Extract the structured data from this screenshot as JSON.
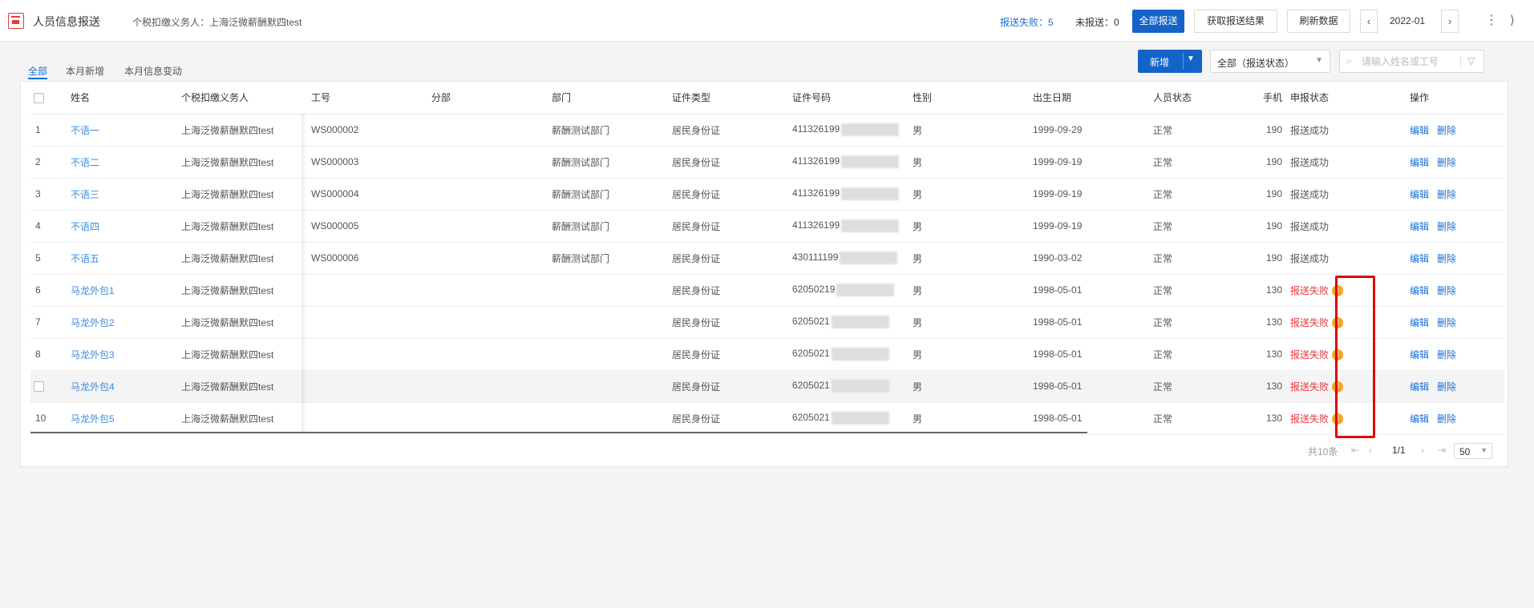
{
  "app": {
    "title": "人员信息报送",
    "payer": "个税扣缴义务人：上海泛微薪酬默四test"
  },
  "stats": {
    "fail": "报送失败：5",
    "pending": "未报送：0"
  },
  "toolbar": {
    "submit_all": "全部报送",
    "fetch_result": "获取报送结果",
    "refresh": "刷新数据",
    "period": "2022-01"
  },
  "tabs": [
    "全部",
    "本月新增",
    "本月信息变动"
  ],
  "filters": {
    "add_label": "新增",
    "status_select": "全部（报送状态）",
    "search_placeholder": "请输入姓名或工号"
  },
  "columns": [
    "姓名",
    "个税扣缴义务人",
    "工号",
    "分部",
    "部门",
    "证件类型",
    "证件号码",
    "性别",
    "出生日期",
    "人员状态",
    "手机",
    "申报状态",
    "操作"
  ],
  "rows": [
    {
      "idx": "1",
      "name": "不语一",
      "payer": "上海泛微薪酬默四test",
      "empno": "WS000002",
      "branch": "",
      "dept": "薪酬测试部门",
      "idtype": "居民身份证",
      "idno": "411326199",
      "gender": "男",
      "birth": "1999-09-29",
      "status": "正常",
      "phone": "190",
      "report": "报送成功",
      "fail": false
    },
    {
      "idx": "2",
      "name": "不语二",
      "payer": "上海泛微薪酬默四test",
      "empno": "WS000003",
      "branch": "",
      "dept": "薪酬测试部门",
      "idtype": "居民身份证",
      "idno": "411326199",
      "gender": "男",
      "birth": "1999-09-19",
      "status": "正常",
      "phone": "190",
      "report": "报送成功",
      "fail": false
    },
    {
      "idx": "3",
      "name": "不语三",
      "payer": "上海泛微薪酬默四test",
      "empno": "WS000004",
      "branch": "",
      "dept": "薪酬测试部门",
      "idtype": "居民身份证",
      "idno": "411326199",
      "gender": "男",
      "birth": "1999-09-19",
      "status": "正常",
      "phone": "190",
      "report": "报送成功",
      "fail": false
    },
    {
      "idx": "4",
      "name": "不语四",
      "payer": "上海泛微薪酬默四test",
      "empno": "WS000005",
      "branch": "",
      "dept": "薪酬测试部门",
      "idtype": "居民身份证",
      "idno": "411326199",
      "gender": "男",
      "birth": "1999-09-19",
      "status": "正常",
      "phone": "190",
      "report": "报送成功",
      "fail": false
    },
    {
      "idx": "5",
      "name": "不语五",
      "payer": "上海泛微薪酬默四test",
      "empno": "WS000006",
      "branch": "",
      "dept": "薪酬测试部门",
      "idtype": "居民身份证",
      "idno": "430111199",
      "gender": "男",
      "birth": "1990-03-02",
      "status": "正常",
      "phone": "190",
      "report": "报送成功",
      "fail": false
    },
    {
      "idx": "6",
      "name": "马龙外包1",
      "payer": "上海泛微薪酬默四test",
      "empno": "",
      "branch": "",
      "dept": "",
      "idtype": "居民身份证",
      "idno": "62050219",
      "gender": "男",
      "birth": "1998-05-01",
      "status": "正常",
      "phone": "130",
      "report": "报送失败",
      "fail": true
    },
    {
      "idx": "7",
      "name": "马龙外包2",
      "payer": "上海泛微薪酬默四test",
      "empno": "",
      "branch": "",
      "dept": "",
      "idtype": "居民身份证",
      "idno": "6205021",
      "gender": "男",
      "birth": "1998-05-01",
      "status": "正常",
      "phone": "130",
      "report": "报送失败",
      "fail": true
    },
    {
      "idx": "8",
      "name": "马龙外包3",
      "payer": "上海泛微薪酬默四test",
      "empno": "",
      "branch": "",
      "dept": "",
      "idtype": "居民身份证",
      "idno": "6205021",
      "gender": "男",
      "birth": "1998-05-01",
      "status": "正常",
      "phone": "130",
      "report": "报送失败",
      "fail": true
    },
    {
      "idx": "",
      "name": "马龙外包4",
      "payer": "上海泛微薪酬默四test",
      "empno": "",
      "branch": "",
      "dept": "",
      "idtype": "居民身份证",
      "idno": "6205021",
      "gender": "男",
      "birth": "1998-05-01",
      "status": "正常",
      "phone": "130",
      "report": "报送失败",
      "fail": true,
      "hover": true
    },
    {
      "idx": "10",
      "name": "马龙外包5",
      "payer": "上海泛微薪酬默四test",
      "empno": "",
      "branch": "",
      "dept": "",
      "idtype": "居民身份证",
      "idno": "6205021",
      "gender": "男",
      "birth": "1998-05-01",
      "status": "正常",
      "phone": "130",
      "report": "报送失败",
      "fail": true
    }
  ],
  "actions": {
    "edit": "编辑",
    "delete": "删除"
  },
  "pagination": {
    "total": "共10条",
    "page": "1/1",
    "size": "50"
  },
  "colors": {
    "primary": "#1464c8",
    "link": "#3b8de0",
    "fail": "#e4393c",
    "warn": "#f5a623",
    "highlight_box": "#e00000"
  }
}
